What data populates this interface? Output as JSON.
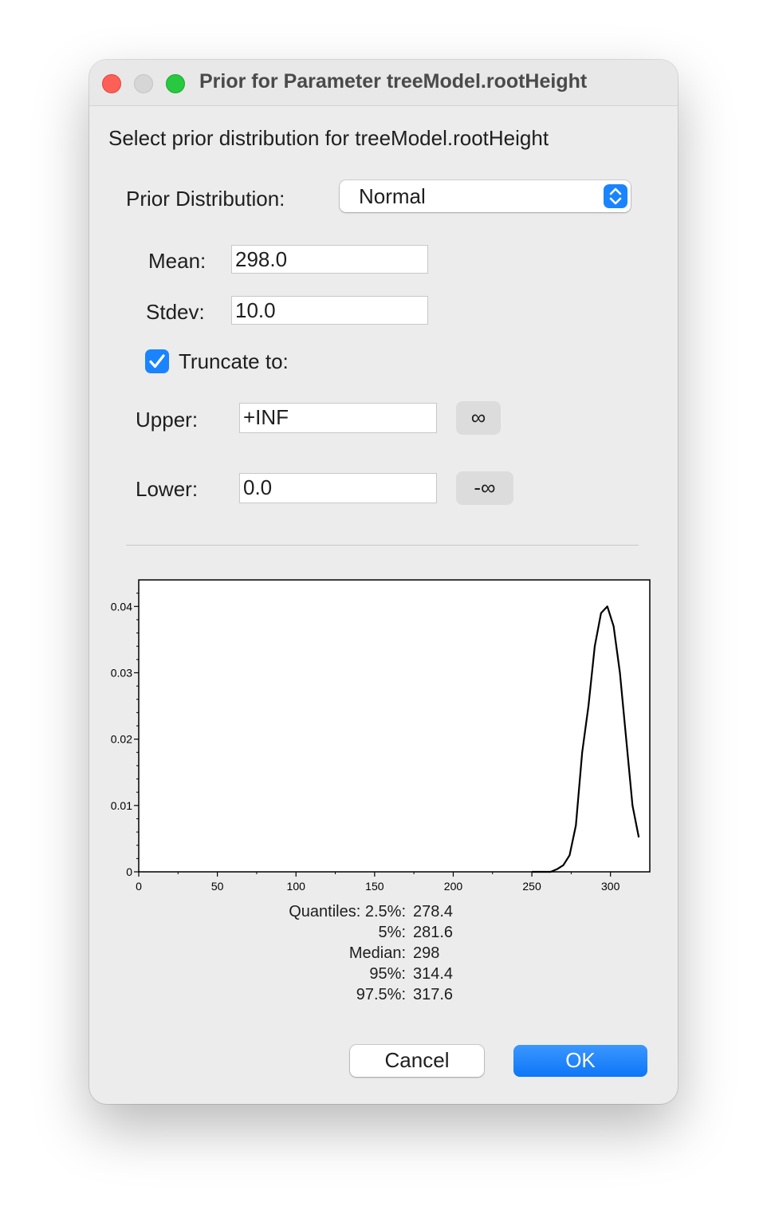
{
  "window": {
    "title": "Prior for Parameter treeModel.rootHeight"
  },
  "dialog": {
    "heading": "Select prior distribution for treeModel.rootHeight",
    "distribution_label": "Prior Distribution:",
    "distribution_value": "Normal",
    "mean_label": "Mean:",
    "mean_value": "298.0",
    "stdev_label": "Stdev:",
    "stdev_value": "10.0",
    "truncate_label": "Truncate to:",
    "truncate_checked": true,
    "upper_label": "Upper:",
    "upper_value": "+INF",
    "upper_button": "∞",
    "lower_label": "Lower:",
    "lower_value": "0.0",
    "lower_button": "-∞"
  },
  "chart_data": {
    "type": "line",
    "title": "",
    "xlabel": "",
    "ylabel": "",
    "xlim": [
      0,
      325
    ],
    "ylim": [
      0,
      0.044
    ],
    "x_ticks": [
      0,
      50,
      100,
      150,
      200,
      250,
      300
    ],
    "y_ticks": [
      0,
      0.01,
      0.02,
      0.03,
      0.04
    ],
    "x_tick_labels": [
      "0",
      "50",
      "100",
      "150",
      "200",
      "250",
      "300"
    ],
    "y_tick_labels": [
      "0",
      "0.01",
      "0.02",
      "0.03",
      "0.04"
    ],
    "grid": false,
    "series": [
      {
        "values_x": [
          250,
          262,
          266,
          270,
          274,
          278,
          282,
          286,
          290,
          294,
          298,
          302,
          306,
          310,
          314,
          318
        ],
        "values_y": [
          0,
          0.0,
          0.0004,
          0.001,
          0.0025,
          0.007,
          0.018,
          0.025,
          0.034,
          0.039,
          0.04,
          0.037,
          0.03,
          0.02,
          0.01,
          0.0052
        ]
      }
    ]
  },
  "quantiles": [
    {
      "label": "Quantiles: 2.5%:",
      "value": "278.4"
    },
    {
      "label": "5%:",
      "value": "281.6"
    },
    {
      "label": "Median:",
      "value": "298"
    },
    {
      "label": "95%:",
      "value": "314.4"
    },
    {
      "label": "97.5%:",
      "value": "317.6"
    }
  ],
  "buttons": {
    "cancel": "Cancel",
    "ok": "OK"
  }
}
